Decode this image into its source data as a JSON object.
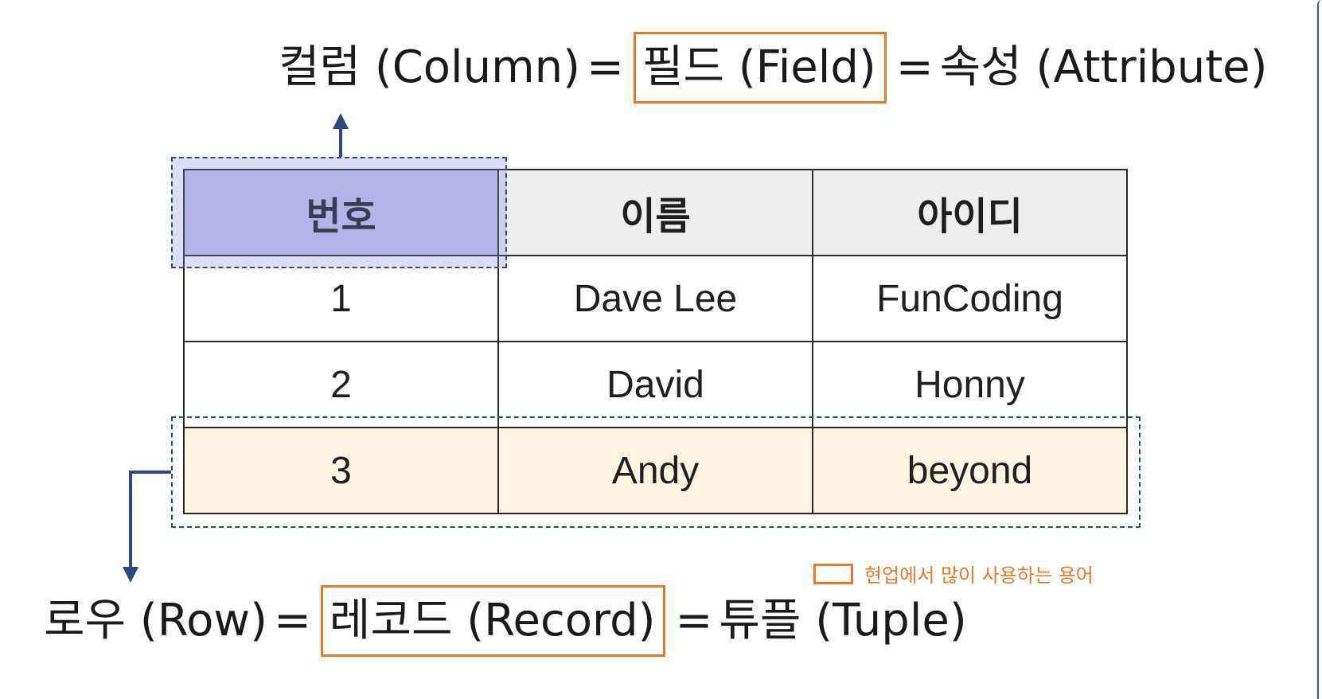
{
  "column_term": {
    "prefix": "컬럼 (Column)",
    "eq1": "=",
    "highlighted": "필드 (Field)",
    "eq2": "=",
    "suffix": "속성 (Attribute)"
  },
  "row_term": {
    "prefix": "로우 (Row)",
    "eq1": "=",
    "highlighted": "레코드 (Record)",
    "eq2": "=",
    "suffix": "튜플 (Tuple)"
  },
  "table": {
    "headers": [
      "번호",
      "이름",
      "아이디"
    ],
    "rows": [
      [
        "1",
        "Dave Lee",
        "FunCoding"
      ],
      [
        "2",
        "David",
        "Honny"
      ],
      [
        "3",
        "Andy",
        "beyond"
      ]
    ]
  },
  "legend": {
    "label": "현업에서 많이 사용하는 용어"
  },
  "colors": {
    "highlight_border": "#e8792a",
    "column_fill": "#c7c4ec",
    "row_fill": "#fdf5e2",
    "dash_and_arrow": "#2c4b7c",
    "header_fill": "#eeeeee"
  }
}
